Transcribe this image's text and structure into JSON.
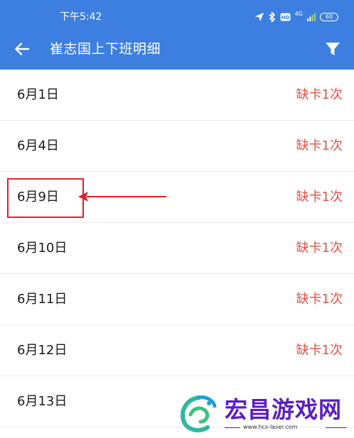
{
  "status_bar": {
    "time": "下午5:42",
    "network": "4G",
    "battery": "60",
    "icons": [
      "location-arrow-icon",
      "bluetooth-icon",
      "hd-icon",
      "signal-icon",
      "battery-icon"
    ]
  },
  "app_bar": {
    "title": "崔志国上下班明细",
    "back_icon": "arrow-left-icon",
    "filter_icon": "funnel-filter-icon"
  },
  "records": [
    {
      "date": "6月1日",
      "status": "缺卡1次"
    },
    {
      "date": "6月4日",
      "status": "缺卡1次"
    },
    {
      "date": "6月9日",
      "status": "缺卡1次"
    },
    {
      "date": "6月10日",
      "status": "缺卡1次"
    },
    {
      "date": "6月11日",
      "status": "缺卡1次"
    },
    {
      "date": "6月12日",
      "status": "缺卡1次"
    },
    {
      "date": "6月13日",
      "status": ""
    }
  ],
  "watermark": {
    "name": "宏昌游戏网",
    "url": "www.hcs-laser.com"
  },
  "colors": {
    "header_bg": "#3d7fe0",
    "status_red": "#e0534a",
    "annotation_red": "#e2202a",
    "watermark_purple": "#5a1ec0"
  }
}
